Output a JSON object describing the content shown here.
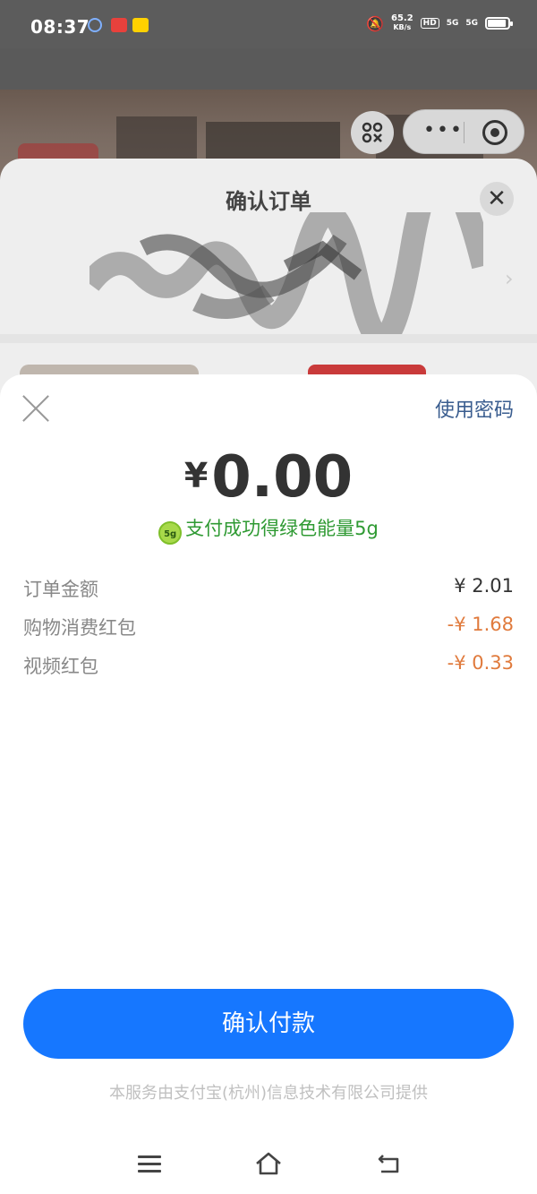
{
  "status_bar": {
    "time": "08:37",
    "speed_value": "65.2",
    "speed_unit": "KB/s",
    "hd_tag": "HD",
    "net1": "5G",
    "net2": "5G"
  },
  "order_sheet": {
    "title": "确认订单",
    "close_glyph": "✕"
  },
  "payment": {
    "use_password_label": "使用密码",
    "currency_symbol": "¥",
    "amount": "0.00",
    "energy_badge": "5g",
    "energy_text": "支付成功得绿色能量5g",
    "details": [
      {
        "label": "订单金额",
        "value": "¥ 2.01",
        "type": "normal"
      },
      {
        "label": "购物消费红包",
        "value": "-¥ 1.68",
        "type": "discount"
      },
      {
        "label": "视频红包",
        "value": "-¥ 0.33",
        "type": "discount"
      }
    ],
    "confirm_label": "确认付款",
    "provider_text": "本服务由支付宝(杭州)信息技术有限公司提供"
  },
  "colors": {
    "primary_blue": "#1677ff",
    "link_blue": "#3a5d8f",
    "energy_green": "#2f9a33",
    "discount_orange": "#e07a3c"
  },
  "icons": {
    "scan": "qr-scan-icon",
    "more": "more-dots-icon",
    "target": "close-miniapp-icon",
    "nav_menu": "menu-icon",
    "nav_home": "home-icon",
    "nav_back": "back-icon"
  }
}
